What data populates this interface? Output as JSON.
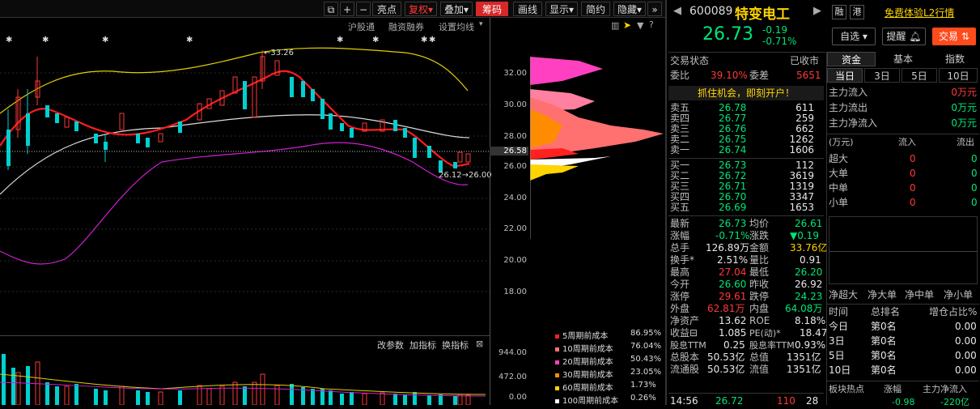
{
  "toolbar": {
    "nav": [
      "+",
      "−"
    ],
    "items": [
      "亮点",
      "复权",
      "叠加",
      "筹码",
      "画线",
      "显示",
      "简约",
      "隐藏"
    ],
    "next": "»"
  },
  "chart_header": {
    "links": [
      "沪股通",
      "融资融券",
      "设置均线"
    ]
  },
  "sub_header": {
    "links": [
      "改参数",
      "加指标",
      "换指标"
    ]
  },
  "price_axis": [
    "32.00",
    "30.00",
    "28.00",
    "26.58",
    "26.00",
    "24.00",
    "22.00",
    "20.00",
    "18.00"
  ],
  "volume_axis": [
    "944.00",
    "472.00",
    "0.00"
  ],
  "annotations": {
    "high": "33.26",
    "low": "26.12→26.00"
  },
  "cost_legend": [
    {
      "label": "5周期前成本",
      "pct": "86.95%",
      "color": "#ff2020"
    },
    {
      "label": "10周期前成本",
      "pct": "76.04%",
      "color": "#ff7070"
    },
    {
      "label": "20周期前成本",
      "pct": "50.43%",
      "color": "#ff40c0"
    },
    {
      "label": "30周期前成本",
      "pct": "23.05%",
      "color": "#ff8c00"
    },
    {
      "label": "60周期前成本",
      "pct": "1.73%",
      "color": "#ffd400"
    },
    {
      "label": "100周期前成本",
      "pct": "0.26%",
      "color": "#ffffff"
    }
  ],
  "stock": {
    "code": "600089",
    "name": "特变电工",
    "price": "26.73",
    "change": "-0.19",
    "pct": "-0.71%",
    "rong": "融",
    "gang": "港",
    "promo": "免费体验L2行情",
    "btn_watch": "自选",
    "btn_alert": "提醒",
    "btn_trade": "交易"
  },
  "status": {
    "label": "交易状态",
    "value": "已收市"
  },
  "webi": {
    "l1": "委比",
    "v1": "39.10%",
    "l2": "委差",
    "v2": "5651"
  },
  "banner": "抓住机会，即刻开户！",
  "sells": [
    {
      "n": "卖五",
      "p": "26.78",
      "v": "611"
    },
    {
      "n": "卖四",
      "p": "26.77",
      "v": "259"
    },
    {
      "n": "卖三",
      "p": "26.76",
      "v": "662"
    },
    {
      "n": "卖二",
      "p": "26.75",
      "v": "1262"
    },
    {
      "n": "卖一",
      "p": "26.74",
      "v": "1606"
    }
  ],
  "buys": [
    {
      "n": "买一",
      "p": "26.73",
      "v": "112"
    },
    {
      "n": "买二",
      "p": "26.72",
      "v": "3619"
    },
    {
      "n": "买三",
      "p": "26.71",
      "v": "1319"
    },
    {
      "n": "买四",
      "p": "26.70",
      "v": "3347"
    },
    {
      "n": "买五",
      "p": "26.69",
      "v": "1653"
    }
  ],
  "quote": [
    [
      "最新",
      "26.73",
      "均价",
      "26.61"
    ],
    [
      "涨幅",
      "-0.71%",
      "涨跌",
      "▼0.19"
    ],
    [
      "总手",
      "126.89万",
      "金额",
      "33.76亿"
    ],
    [
      "换手*",
      "2.51%",
      "量比",
      "0.91"
    ],
    [
      "最高",
      "27.04",
      "最低",
      "26.20"
    ],
    [
      "今开",
      "26.60",
      "昨收",
      "26.92"
    ],
    [
      "涨停",
      "29.61",
      "跌停",
      "24.23"
    ],
    [
      "外盘",
      "62.81万",
      "内盘",
      "64.08万"
    ],
    [
      "净资产",
      "13.62",
      "ROE",
      "8.18%"
    ],
    [
      "收益⊟",
      "1.085",
      "PE(动)*",
      "18.47"
    ],
    [
      "股息TTM",
      "0.25",
      "股息率TTM",
      "0.93%"
    ],
    [
      "总股本",
      "50.53亿",
      "总值",
      "1351亿"
    ],
    [
      "流通股",
      "50.53亿",
      "流值",
      "1351亿"
    ]
  ],
  "tick": {
    "time": "14:56",
    "price": "26.72",
    "vol": "110",
    "num": "28"
  },
  "fund_tabs": [
    "资金",
    "基本",
    "指数"
  ],
  "period_tabs": [
    "当日",
    "3日",
    "5日",
    "10日"
  ],
  "flows": [
    {
      "l": "主力流入",
      "v": "0万元"
    },
    {
      "l": "主力流出",
      "v": "0万元"
    },
    {
      "l": "主力净流入",
      "v": "0万元"
    }
  ],
  "flow_table": {
    "headers": [
      "(万元)",
      "流入",
      "流出"
    ],
    "rows": [
      [
        "超大",
        "0",
        "0"
      ],
      [
        "大单",
        "0",
        "0"
      ],
      [
        "中单",
        "0",
        "0"
      ],
      [
        "小单",
        "0",
        "0"
      ]
    ]
  },
  "net_labels": [
    "净超大",
    "净大单",
    "净中单",
    "净小单"
  ],
  "rank_table": {
    "headers": [
      "时间",
      "总排名",
      "增仓占比%"
    ],
    "rows": [
      [
        "今日",
        "第0名",
        "0.00"
      ],
      [
        "3日",
        "第0名",
        "0.00"
      ],
      [
        "5日",
        "第0名",
        "0.00"
      ],
      [
        "10日",
        "第0名",
        "0.00"
      ]
    ]
  },
  "bottom_row": {
    "a": "板块热点",
    "b": "涨幅",
    "c": "主力净流入",
    "v1": "-0.98",
    "v2": "-220亿"
  }
}
